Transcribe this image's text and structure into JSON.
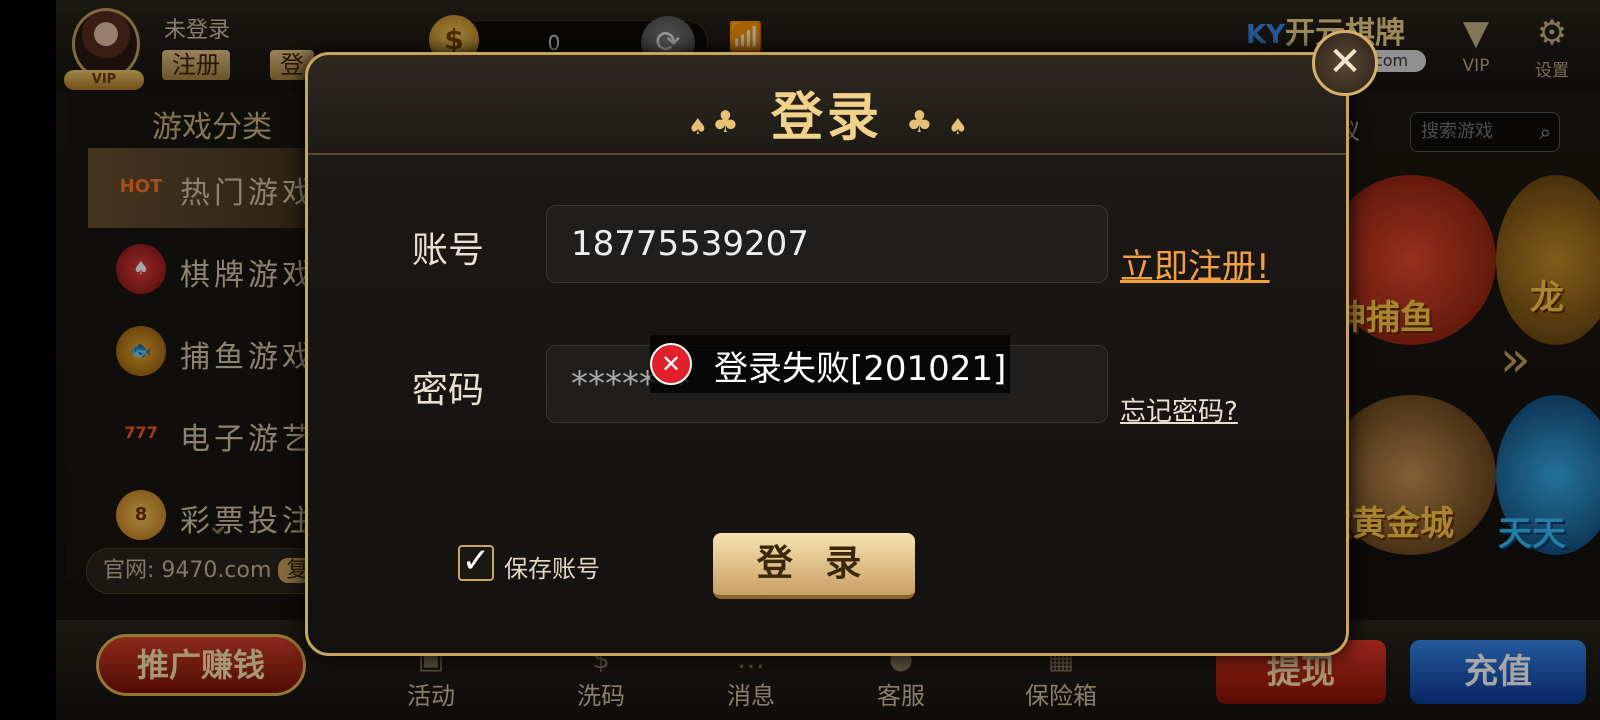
{
  "header": {
    "username": "未登录",
    "register_label": "注册",
    "login_label": "登",
    "vip_badge": "VIP",
    "coin_balance": "0",
    "brand": "开元棋牌",
    "brand_sub": "com",
    "vip_label": "VIP",
    "settings_label": "设置"
  },
  "sidebar": {
    "title": "游戏分类",
    "items": [
      {
        "label": "热门游戏",
        "icon": "HOT"
      },
      {
        "label": "棋牌游戏"
      },
      {
        "label": "捕鱼游戏"
      },
      {
        "label": "电子游艺",
        "icon": "777"
      },
      {
        "label": "彩票投注"
      }
    ],
    "site": "官网: 9470.com",
    "copy_label": "复"
  },
  "games": {
    "suggest": "建议",
    "search_placeholder": "搜索游戏",
    "titles": [
      "神捕鱼",
      "龙",
      "宝黄金城",
      "天天"
    ]
  },
  "bottom": {
    "promo": "推广赚钱",
    "nav": [
      "活动",
      "洗码",
      "消息",
      "客服",
      "保险箱"
    ],
    "withdraw": "提现",
    "recharge": "充值"
  },
  "login_dialog": {
    "title": "登录",
    "account_label": "账号",
    "account_value": "18775539207",
    "password_label": "密码",
    "password_value": "*******",
    "register_link": "立即注册!",
    "forgot_link": "忘记密码?",
    "save_account_label": "保存账号",
    "save_account_checked": true,
    "login_button": "登 录",
    "error_toast": "登录失败[201021]"
  },
  "colors": {
    "gold": "#c9a45c",
    "error": "#e0202a",
    "link": "#f0a040"
  }
}
